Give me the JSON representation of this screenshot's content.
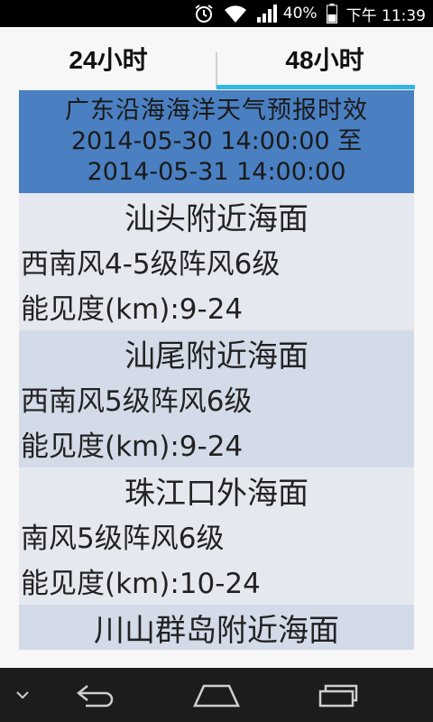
{
  "status_bar": {
    "battery": "40%",
    "time": "下午 11:39",
    "icons": [
      "alarm-icon",
      "wifi-icon",
      "signal-icon",
      "battery-icon"
    ]
  },
  "tabs": [
    {
      "label": "24小时",
      "selected": false
    },
    {
      "label": "48小时",
      "selected": true
    }
  ],
  "header": {
    "title": "广东沿海海洋天气预报时效",
    "line1": "2014-05-30 14:00:00 至",
    "line2": "2014-05-31 14:00:00"
  },
  "areas": [
    {
      "name": "汕头附近海面",
      "wind": "西南风4-5级阵风6级",
      "visibility": "能见度(km):9-24"
    },
    {
      "name": "汕尾附近海面",
      "wind": "西南风5级阵风6级",
      "visibility": "能见度(km):9-24"
    },
    {
      "name": "珠江口外海面",
      "wind": "南风5级阵风6级",
      "visibility": "能见度(km):10-24"
    },
    {
      "name": "川山群岛附近海面",
      "wind": "",
      "visibility": ""
    }
  ],
  "nav_bar": {
    "icons": [
      "chevron-down-icon",
      "back-icon",
      "home-icon",
      "recent-apps-icon"
    ]
  },
  "colors": {
    "header_bg": "#4a7fc1",
    "tab_indicator": "#33b5e5",
    "row_light": "#e6e8f0",
    "row_dark": "#d3dae8"
  }
}
